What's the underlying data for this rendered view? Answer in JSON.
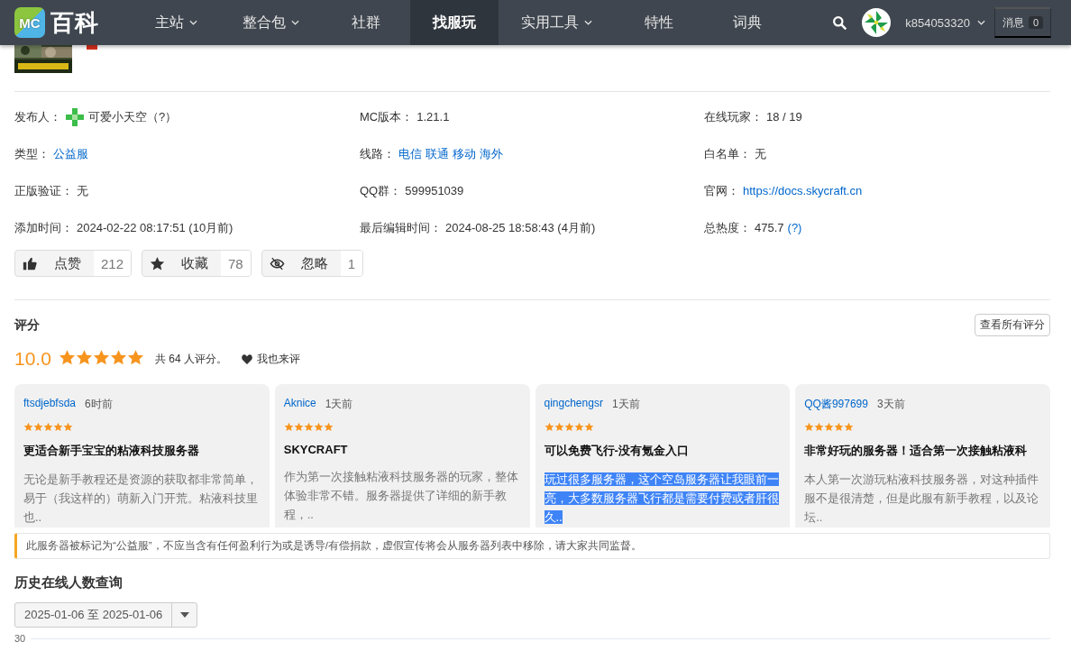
{
  "navbar": {
    "logo_badge": "MC",
    "logo_text": "百科",
    "items": [
      {
        "label": "主站",
        "dropdown": true,
        "selected": false
      },
      {
        "label": "整合包",
        "dropdown": true,
        "selected": false
      },
      {
        "label": "社群",
        "dropdown": false,
        "selected": false
      },
      {
        "label": "找服玩",
        "dropdown": false,
        "selected": true
      },
      {
        "label": "实用工具",
        "dropdown": true,
        "selected": false
      },
      {
        "label": "特性",
        "dropdown": false,
        "selected": false
      },
      {
        "label": "词典",
        "dropdown": false,
        "selected": false
      }
    ],
    "username": "k854053320",
    "messages_label": "消息",
    "messages_count": "0"
  },
  "info": [
    {
      "label": "发布人：",
      "parts": [
        {
          "kind": "avatar"
        },
        {
          "kind": "text",
          "text": "可爱小天空（?）"
        }
      ]
    },
    {
      "label": "MC版本：",
      "parts": [
        {
          "kind": "text",
          "text": "1.21.1"
        }
      ]
    },
    {
      "label": "在线玩家：",
      "parts": [
        {
          "kind": "text",
          "text": "18 / 19"
        }
      ]
    },
    {
      "label": "类型：",
      "parts": [
        {
          "kind": "link",
          "text": "公益服"
        }
      ]
    },
    {
      "label": "线路：",
      "parts": [
        {
          "kind": "link",
          "text": "电信"
        },
        {
          "kind": "link",
          "text": "联通"
        },
        {
          "kind": "link",
          "text": "移动"
        },
        {
          "kind": "link",
          "text": "海外"
        }
      ]
    },
    {
      "label": "白名单：",
      "parts": [
        {
          "kind": "text",
          "text": "无"
        }
      ]
    },
    {
      "label": "正版验证：",
      "parts": [
        {
          "kind": "text",
          "text": "无"
        }
      ]
    },
    {
      "label": "QQ群：",
      "parts": [
        {
          "kind": "text",
          "text": "599951039"
        }
      ]
    },
    {
      "label": "官网：",
      "parts": [
        {
          "kind": "link",
          "text": "https://docs.skycraft.cn"
        }
      ]
    },
    {
      "label": "添加时间：",
      "parts": [
        {
          "kind": "text",
          "text": "2024-02-22 08:17:51 (10月前)"
        }
      ]
    },
    {
      "label": "最后编辑时间：",
      "parts": [
        {
          "kind": "text",
          "text": "2024-08-25 18:58:43 (4月前)"
        }
      ]
    },
    {
      "label": "总热度：",
      "parts": [
        {
          "kind": "text",
          "text": "475.7"
        },
        {
          "kind": "link",
          "text": "(?)"
        }
      ]
    }
  ],
  "actions": [
    {
      "kind": "like",
      "label": "点赞",
      "count": "212"
    },
    {
      "kind": "favorite",
      "label": "收藏",
      "count": "78"
    },
    {
      "kind": "ignore",
      "label": "忽略",
      "count": "1"
    }
  ],
  "rating": {
    "title": "评分",
    "view_all": "查看所有评分",
    "score": "10.0",
    "stars": 5,
    "summary": "共 64 人评分。",
    "rate_link": "我也来评",
    "reviews": [
      {
        "user": "ftsdjebfsda",
        "time": "6时前",
        "stars": 5,
        "title": "更适合新手宝宝的粘液科技服务器",
        "body": "无论是新手教程还是资源的获取都非常简单，易于（我这样的）萌新入门开荒。粘液科技里也..",
        "highlighted": false
      },
      {
        "user": "Aknice",
        "time": "1天前",
        "stars": 5,
        "title": "SKYCRAFT",
        "body": "作为第一次接触粘液科技服务器的玩家，整体体验非常不错。服务器提供了详细的新手教程，..",
        "highlighted": false
      },
      {
        "user": "qingchengsr",
        "time": "1天前",
        "stars": 5,
        "title": "可以免费飞行-没有氪金入口",
        "body": "玩过很多服务器，这个空岛服务器让我眼前一亮，大多数服务器飞行都是需要付费或者肝很久..",
        "highlighted": true
      },
      {
        "user": "QQ酱997699",
        "time": "3天前",
        "stars": 5,
        "title": "非常好玩的服务器！适合第一次接触粘液科",
        "body": "本人第一次游玩粘液科技服务器，对这种插件服不是很清楚，但是此服有新手教程，以及论坛..",
        "highlighted": false
      }
    ]
  },
  "notice": "此服务器被标记为“公益服”，不应当含有任何盈利行为或是诱导/有偿捐款，虚假宣传将会从服务器列表中移除，请大家共同监督。",
  "history": {
    "title": "历史在线人数查询",
    "date_range": "2025-01-06 至 2025-01-06",
    "axis_label": "30"
  }
}
